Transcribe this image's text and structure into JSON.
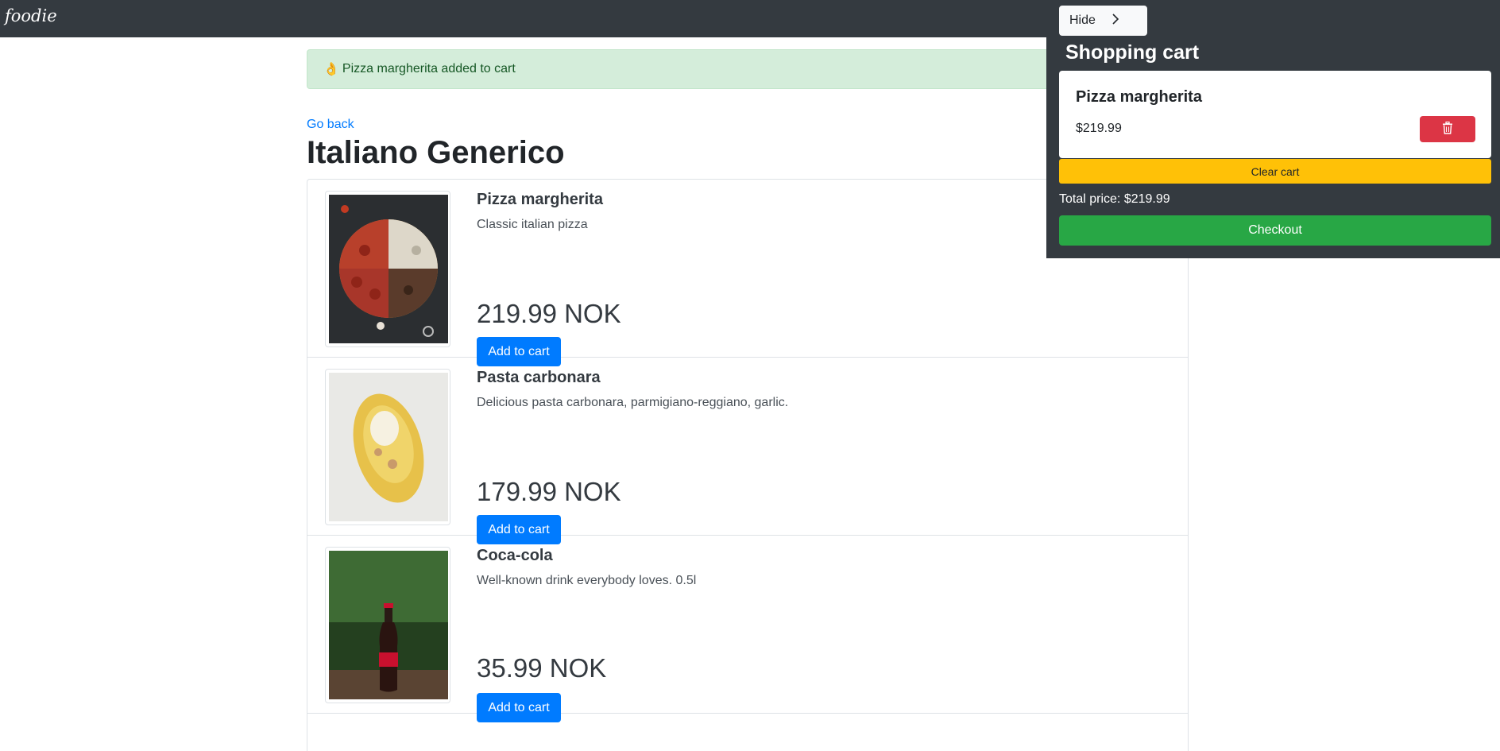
{
  "navbar": {
    "brand": "foodie"
  },
  "alert": {
    "text": "Pizza margherita added to cart",
    "icon": "hand-icon"
  },
  "restaurant": {
    "go_back": "Go back",
    "title": "Italiano Generico"
  },
  "products": [
    {
      "name": "Pizza margherita",
      "description": "Classic italian pizza",
      "price": "219.99 NOK",
      "button": "Add to cart"
    },
    {
      "name": "Pasta carbonara",
      "description": "Delicious pasta carbonara, parmigiano-reggiano, garlic.",
      "price": "179.99 NOK",
      "button": "Add to cart"
    },
    {
      "name": "Coca-cola",
      "description": "Well-known drink everybody loves. 0.5l",
      "price": "35.99 NOK",
      "button": "Add to cart"
    }
  ],
  "cart": {
    "hide_label": "Hide",
    "title": "Shopping cart",
    "items": [
      {
        "name": "Pizza margherita",
        "price": "$219.99"
      }
    ],
    "clear_label": "Clear cart",
    "total": "Total price: $219.99",
    "checkout_label": "Checkout"
  },
  "colors": {
    "navbar": "#343a40",
    "primary": "#007bff",
    "danger": "#dc3545",
    "warning": "#ffc107",
    "success": "#28a745",
    "alert_bg": "#d4edda"
  }
}
